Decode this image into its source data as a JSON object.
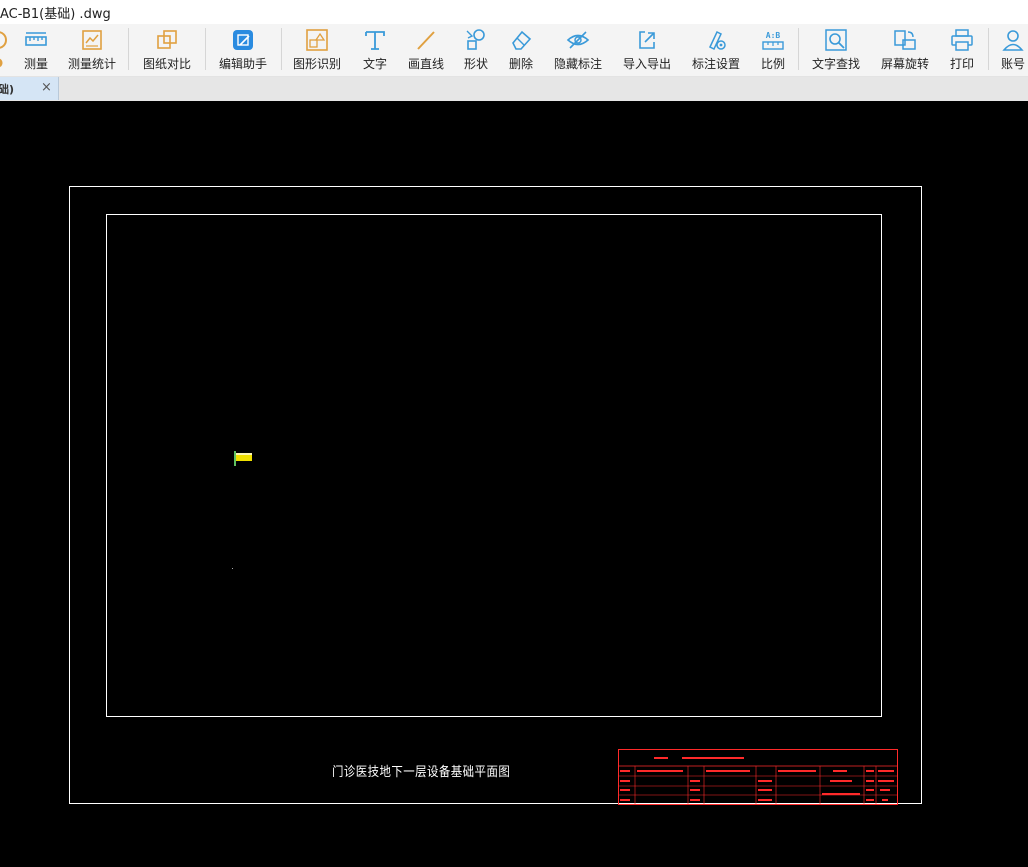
{
  "window": {
    "title": "AC-B1(基础) .dwg"
  },
  "toolbar": {
    "items": [
      {
        "label": "测量",
        "icon": "ruler-icon"
      },
      {
        "label": "测量统计",
        "icon": "measure-stats-icon"
      },
      {
        "label": "图纸对比",
        "icon": "compare-icon"
      },
      {
        "label": "编辑助手",
        "icon": "edit-assistant-icon"
      },
      {
        "label": "图形识别",
        "icon": "shape-recognize-icon"
      },
      {
        "label": "文字",
        "icon": "text-icon"
      },
      {
        "label": "画直线",
        "icon": "line-icon"
      },
      {
        "label": "形状",
        "icon": "shape-icon"
      },
      {
        "label": "删除",
        "icon": "eraser-icon"
      },
      {
        "label": "隐藏标注",
        "icon": "eye-hide-icon"
      },
      {
        "label": "导入导出",
        "icon": "import-export-icon"
      },
      {
        "label": "标注设置",
        "icon": "annotation-settings-icon"
      },
      {
        "label": "比例",
        "icon": "scale-icon"
      },
      {
        "label": "文字查找",
        "icon": "text-search-icon"
      },
      {
        "label": "屏幕旋转",
        "icon": "rotate-screen-icon"
      },
      {
        "label": "打印",
        "icon": "printer-icon"
      },
      {
        "label": "账号",
        "icon": "user-icon"
      }
    ]
  },
  "tab": {
    "label": "础)",
    "close": "×"
  },
  "drawing": {
    "title": "门诊医技地下一层设备基础平面图"
  },
  "colors": {
    "canvas_bg": "#000000",
    "frame": "#ffffff",
    "title_block": "#ff2a2a",
    "marker": "#f0e000",
    "toolbar_icon": "#3a9ad9",
    "toolbar_icon_orange": "#e0a040"
  }
}
